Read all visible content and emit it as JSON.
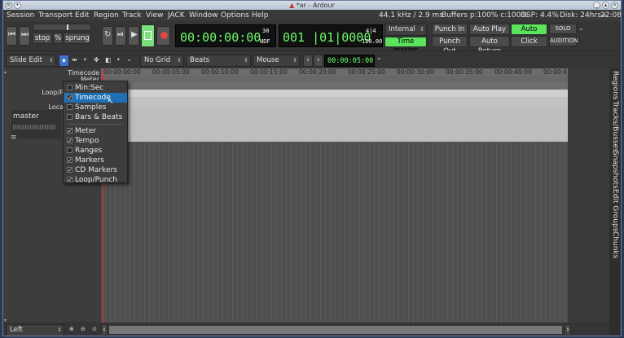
{
  "window": {
    "title": "*ar - Ardour"
  },
  "menu": [
    "Session",
    "Transport",
    "Edit",
    "Region",
    "Track",
    "View",
    "JACK",
    "Window",
    "Options",
    "Help"
  ],
  "status": {
    "sample_rate": "44.1 kHz / 2.9 ms",
    "buffers": "Buffers p:100% c:100%",
    "dsp": "DSP:  4.4%",
    "disk": "Disk: 24hrs+",
    "time": "22:08"
  },
  "transport": {
    "stop_label": "stop",
    "percent_label": "%",
    "sprung_label": "sprung",
    "primary_clock": "00:00:00:00",
    "primary_clock_fps": "30",
    "primary_clock_ndf": "NDF",
    "secondary_clock": "001 |01|0000",
    "meter": "4|4",
    "tempo": "120.00",
    "sync_source": "Internal",
    "time_master": "Time master",
    "punch_in": "Punch In",
    "punch_out": "Punch Out",
    "auto_play": "Auto Play",
    "auto_return": "Auto Return",
    "auto_input": "Auto Input",
    "click": "Click",
    "solo": "SOLO",
    "audition": "AUDITION"
  },
  "editbar": {
    "edit_mode": "Slide Edit",
    "grid": "No Grid",
    "snap_unit": "Beats",
    "edit_point": "Mouse",
    "nudge_clock": "00:00:05:00"
  },
  "rulers": {
    "timecode_label": "Timecode",
    "meter_label": "Meter",
    "loop_label": "Loop/P",
    "loc_label": "Loca",
    "ticks": [
      "00:00:00:00",
      "00:00:05:00",
      "00:00:10:00",
      "00:00:15:00",
      "00:00:20:00",
      "00:00:25:00",
      "00:00:30:00",
      "00:00:35:00",
      "00:00:40:00",
      "00:00:4"
    ]
  },
  "track": {
    "name": "master"
  },
  "popup_items": [
    {
      "label": "Min:Sec",
      "checked": false,
      "selected": false
    },
    {
      "label": "Timecode",
      "checked": true,
      "selected": true
    },
    {
      "label": "Samples",
      "checked": false,
      "selected": false
    },
    {
      "label": "Bars & Beats",
      "checked": false,
      "selected": false
    },
    {
      "label": "Meter",
      "checked": true,
      "selected": false
    },
    {
      "label": "Tempo",
      "checked": true,
      "selected": false
    },
    {
      "label": "Ranges",
      "checked": false,
      "selected": false
    },
    {
      "label": "Markers",
      "checked": true,
      "selected": false
    },
    {
      "label": "CD Markers",
      "checked": true,
      "selected": false
    },
    {
      "label": "Loop/Punch",
      "checked": true,
      "selected": false
    }
  ],
  "sidetabs": [
    "Regions",
    "Tracks/Busses",
    "Snapshots",
    "Edit Groups",
    "Chunks"
  ],
  "bottom": {
    "zoom_focus": "Left"
  },
  "colors": {
    "green": "#6cff6c",
    "selected": "#1e6fb5",
    "auto_input_bg": "#5be35b"
  }
}
